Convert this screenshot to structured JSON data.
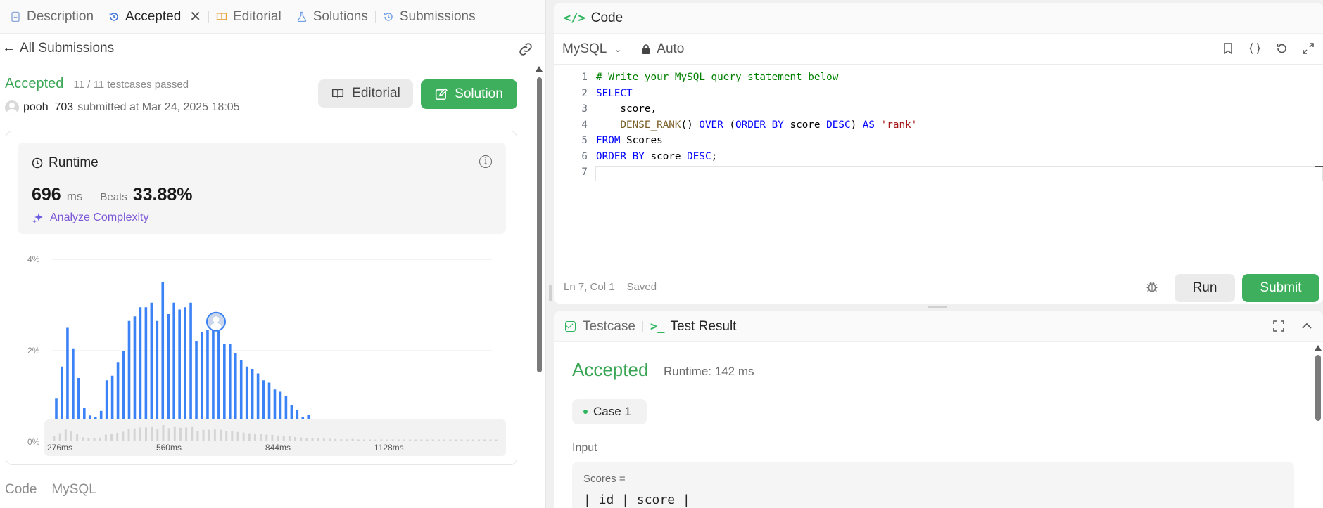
{
  "tabs": [
    {
      "label": "Description"
    },
    {
      "label": "Accepted"
    },
    {
      "label": "Editorial"
    },
    {
      "label": "Solutions"
    },
    {
      "label": "Submissions"
    }
  ],
  "submission": {
    "back_label": "All Submissions",
    "status": "Accepted",
    "passed": "11 / 11 testcases passed",
    "user": "pooh_703",
    "submitted_at": "submitted at Mar 24, 2025 18:05",
    "editorial_btn": "Editorial",
    "solution_btn": "Solution"
  },
  "runtime": {
    "title": "Runtime",
    "value": "696",
    "unit": "ms",
    "beats_label": "Beats",
    "beats_pct": "33.88%",
    "analyze": "Analyze Complexity"
  },
  "chart_data": {
    "type": "bar",
    "title": "",
    "xlabel": "",
    "ylabel": "",
    "ylim": [
      0,
      4
    ],
    "y_ticks": [
      "4%",
      "2%",
      "0%"
    ],
    "x_ticks": [
      "276ms",
      "560ms",
      "844ms",
      "1128ms"
    ],
    "highlight_index": 27,
    "values": [
      0.95,
      1.65,
      2.5,
      2.05,
      1.4,
      0.75,
      0.58,
      0.55,
      0.68,
      1.35,
      1.45,
      1.75,
      2.0,
      2.65,
      2.75,
      2.95,
      2.95,
      3.05,
      2.65,
      3.5,
      2.8,
      3.05,
      2.9,
      2.95,
      3.05,
      2.2,
      2.4,
      2.45,
      2.5,
      2.45,
      2.15,
      2.15,
      1.95,
      1.8,
      1.65,
      1.6,
      1.5,
      1.35,
      1.3,
      1.15,
      1.1,
      1.0,
      0.8,
      0.7,
      0.55,
      0.6,
      0.5,
      0.45,
      0.4,
      0.35,
      0.3,
      0.3,
      0.38,
      0.25,
      0.2,
      0.2,
      0.2,
      0.25,
      0.2,
      0.25,
      0.25,
      0.2,
      0.2,
      0.2,
      0.2,
      0.18,
      0.18,
      0.15,
      0.15,
      0.15,
      0.15,
      0.12,
      0.12,
      0.12,
      0.12,
      0.12,
      0.12,
      0.12
    ]
  },
  "minimap": {
    "ticks": [
      "276ms",
      "560ms",
      "844ms",
      "1128ms"
    ]
  },
  "code_section": {
    "label": "Code",
    "lang": "MySQL"
  },
  "editor": {
    "title": "Code",
    "language": "MySQL",
    "mode": "Auto",
    "line_numbers": [
      "1",
      "2",
      "3",
      "4",
      "5",
      "6",
      "7"
    ],
    "position": "Ln 7, Col 1",
    "saved": "Saved",
    "run": "Run",
    "submit": "Submit"
  },
  "testpanel": {
    "testcase_tab": "Testcase",
    "result_tab": "Test Result",
    "status": "Accepted",
    "runtime": "Runtime: 142 ms",
    "case": "Case 1",
    "input_label": "Input",
    "input_name": "Scores =",
    "input_preview": "| id | score |"
  },
  "colors": {
    "accent_green": "#3eaf5c",
    "bar_blue": "#3b82f6",
    "purple": "#7b57d6"
  }
}
